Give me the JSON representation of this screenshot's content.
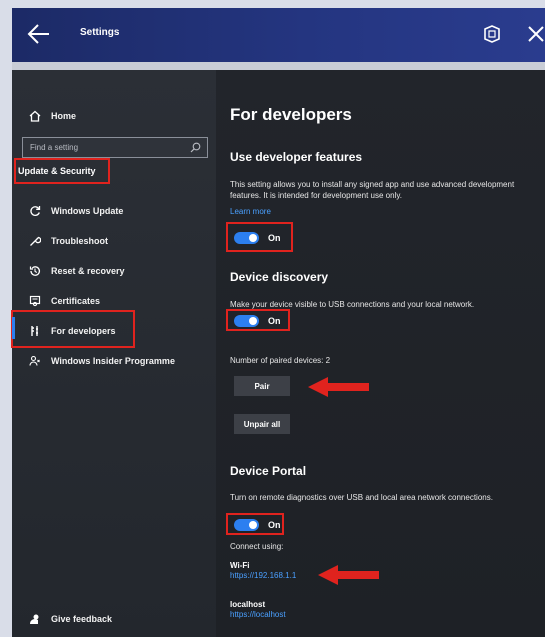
{
  "window": {
    "title": "Settings"
  },
  "sidebar": {
    "home_label": "Home",
    "search_placeholder": "Find a setting",
    "section_header": "Update & Security",
    "items": [
      {
        "label": "Windows Update",
        "icon": "sync-icon"
      },
      {
        "label": "Troubleshoot",
        "icon": "wrench-icon"
      },
      {
        "label": "Reset & recovery",
        "icon": "history-icon"
      },
      {
        "label": "Certificates",
        "icon": "certificate-icon"
      },
      {
        "label": "For developers",
        "icon": "developer-tools-icon"
      },
      {
        "label": "Windows Insider Programme",
        "icon": "insider-icon"
      }
    ],
    "feedback_label": "Give feedback"
  },
  "main": {
    "title": "For developers",
    "developer_features": {
      "heading": "Use developer features",
      "description": "This setting allows you to install any signed app and use advanced development features. It is intended for development use only.",
      "learn_more": "Learn more",
      "toggle_label": "On"
    },
    "device_discovery": {
      "heading": "Device discovery",
      "description": "Make your device visible to USB connections and your local network.",
      "toggle_label": "On",
      "paired_devices_text": "Number of paired devices: 2",
      "pair_label": "Pair",
      "unpair_all_label": "Unpair all"
    },
    "device_portal": {
      "heading": "Device Portal",
      "description": "Turn on remote diagnostics over USB and local area network connections.",
      "toggle_label": "On",
      "connect_using": "Connect using:",
      "wifi_label": "Wi-Fi",
      "wifi_url": "https://192.168.1.1",
      "localhost_label": "localhost",
      "localhost_url": "https://localhost"
    }
  },
  "colors": {
    "accent": "#2c7ff0",
    "link": "#4aa0ff",
    "highlight": "#e0231e",
    "titlebar": "#243580"
  }
}
